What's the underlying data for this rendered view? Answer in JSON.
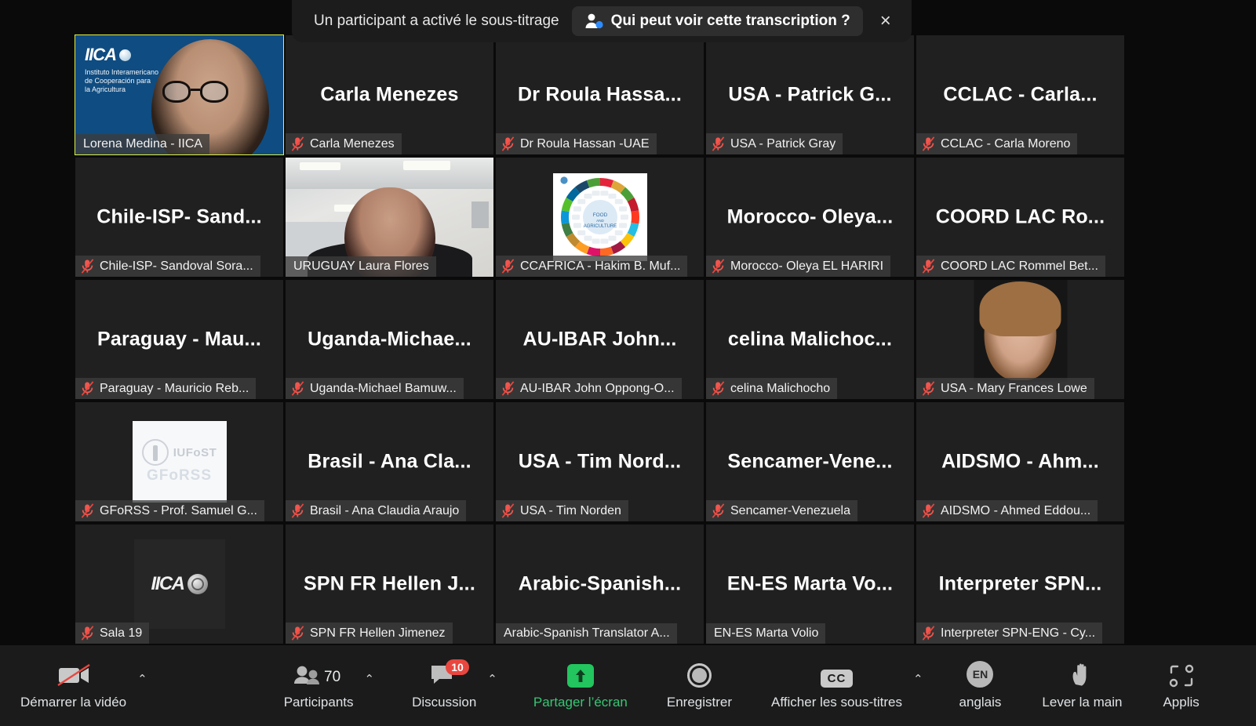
{
  "banner": {
    "message": "Un participant a activé le sous-titrage",
    "pill_label": "Qui peut voir cette transcription ?",
    "pill_icon": "person-add-icon",
    "close_icon": "×"
  },
  "grid": {
    "tiles": [
      {
        "big_name": "",
        "label": "Lorena Medina - IICA",
        "muted": false,
        "speaking": true,
        "media": "iica-video",
        "logo_text": "IICA",
        "logo_sub": "Instituto Interamericano\nde Cooperación para\nla Agricultura"
      },
      {
        "big_name": "Carla Menezes",
        "label": "Carla Menezes",
        "muted": true,
        "speaking": false,
        "media": "none"
      },
      {
        "big_name": "Dr Roula Hassa...",
        "label": "Dr Roula Hassan -UAE",
        "muted": true,
        "speaking": false,
        "media": "none"
      },
      {
        "big_name": "USA - Patrick G...",
        "label": "USA - Patrick Gray",
        "muted": true,
        "speaking": false,
        "media": "none"
      },
      {
        "big_name": "CCLAC - Carla...",
        "label": "CCLAC - Carla Moreno",
        "muted": true,
        "speaking": false,
        "media": "none"
      },
      {
        "big_name": "Chile-ISP- Sand...",
        "label": "Chile-ISP- Sandoval Sora...",
        "muted": true,
        "speaking": false,
        "media": "none"
      },
      {
        "big_name": "",
        "label": "URUGUAY Laura Flores",
        "muted": false,
        "speaking": false,
        "media": "uruguay-video"
      },
      {
        "big_name": "",
        "label": "CCAFRICA - Hakim B. Muf...",
        "muted": true,
        "speaking": false,
        "media": "fao-wheel",
        "wheel_center_line1": "FOOD",
        "wheel_center_line2": "AND",
        "wheel_center_line3": "AGRICULTURE"
      },
      {
        "big_name": "Morocco- Oleya...",
        "label": "Morocco- Oleya EL HARIRI",
        "muted": true,
        "speaking": false,
        "media": "none"
      },
      {
        "big_name": "COORD LAC Ro...",
        "label": "COORD LAC Rommel Bet...",
        "muted": true,
        "speaking": false,
        "media": "none"
      },
      {
        "big_name": "Paraguay - Mau...",
        "label": "Paraguay - Mauricio Reb...",
        "muted": true,
        "speaking": false,
        "media": "none"
      },
      {
        "big_name": "Uganda-Michae...",
        "label": "Uganda-Michael Bamuw...",
        "muted": true,
        "speaking": false,
        "media": "none"
      },
      {
        "big_name": "AU-IBAR John...",
        "label": "AU-IBAR John Oppong-O...",
        "muted": true,
        "speaking": false,
        "media": "none"
      },
      {
        "big_name": "celina Malichoc...",
        "label": "celina Malichocho",
        "muted": true,
        "speaking": false,
        "media": "none"
      },
      {
        "big_name": "",
        "label": "USA - Mary Frances Lowe",
        "muted": true,
        "speaking": false,
        "media": "photo-portrait"
      },
      {
        "big_name": "",
        "label": "GFoRSS - Prof. Samuel G...",
        "muted": true,
        "speaking": false,
        "media": "gforss-logo",
        "logo_text": "IUFoST",
        "logo_sub": "GFoRSS"
      },
      {
        "big_name": "Brasil - Ana Cla...",
        "label": "Brasil - Ana Claudia Araujo",
        "muted": true,
        "speaking": false,
        "media": "none"
      },
      {
        "big_name": "USA - Tim Nord...",
        "label": "USA - Tim Norden",
        "muted": true,
        "speaking": false,
        "media": "none"
      },
      {
        "big_name": "Sencamer-Vene...",
        "label": "Sencamer-Venezuela",
        "muted": true,
        "speaking": false,
        "media": "none"
      },
      {
        "big_name": "AIDSMO - Ahm...",
        "label": "AIDSMO - Ahmed Eddou...",
        "muted": true,
        "speaking": false,
        "media": "none"
      },
      {
        "big_name": "",
        "label": "Sala 19",
        "muted": true,
        "speaking": false,
        "media": "iica-dark-logo",
        "logo_text": "IICA"
      },
      {
        "big_name": "SPN FR Hellen J...",
        "label": "SPN FR Hellen Jimenez",
        "muted": true,
        "speaking": false,
        "media": "none"
      },
      {
        "big_name": "Arabic-Spanish...",
        "label": "Arabic-Spanish Translator A...",
        "muted": false,
        "speaking": false,
        "media": "none"
      },
      {
        "big_name": "EN-ES Marta Vo...",
        "label": "EN-ES Marta Volio",
        "muted": false,
        "speaking": false,
        "media": "none"
      },
      {
        "big_name": "Interpreter SPN...",
        "label": "Interpreter SPN-ENG - Cy...",
        "muted": true,
        "speaking": false,
        "media": "none"
      }
    ]
  },
  "toolbar": {
    "items": [
      {
        "label": "Démarrer la vidéo",
        "icon": "video-off-icon",
        "caret": true,
        "value": ""
      },
      {
        "label": "Participants",
        "icon": "participants-icon",
        "caret": true,
        "value": "70"
      },
      {
        "label": "Discussion",
        "icon": "chat-icon",
        "caret": true,
        "badge": "10"
      },
      {
        "label": "Partager l’écran",
        "icon": "share-screen-icon",
        "caret": false,
        "accent": "#37c674"
      },
      {
        "label": "Enregistrer",
        "icon": "record-icon",
        "caret": false
      },
      {
        "label": "Afficher les sous-titres",
        "icon": "cc-icon",
        "caret": true
      },
      {
        "label": "anglais",
        "icon": "language-icon",
        "caret": false,
        "value": "EN"
      },
      {
        "label": "Lever la main",
        "icon": "raise-hand-icon",
        "caret": false
      },
      {
        "label": "Applis",
        "icon": "apps-icon",
        "caret": false
      }
    ]
  },
  "colors": {
    "accent_green": "#37c674",
    "speaking_border": "#d9f24f",
    "muted_red": "#f1564e",
    "badge_red": "#e8473f",
    "tile_bg": "#202020",
    "toolbar_bg": "#1b1b1b"
  }
}
